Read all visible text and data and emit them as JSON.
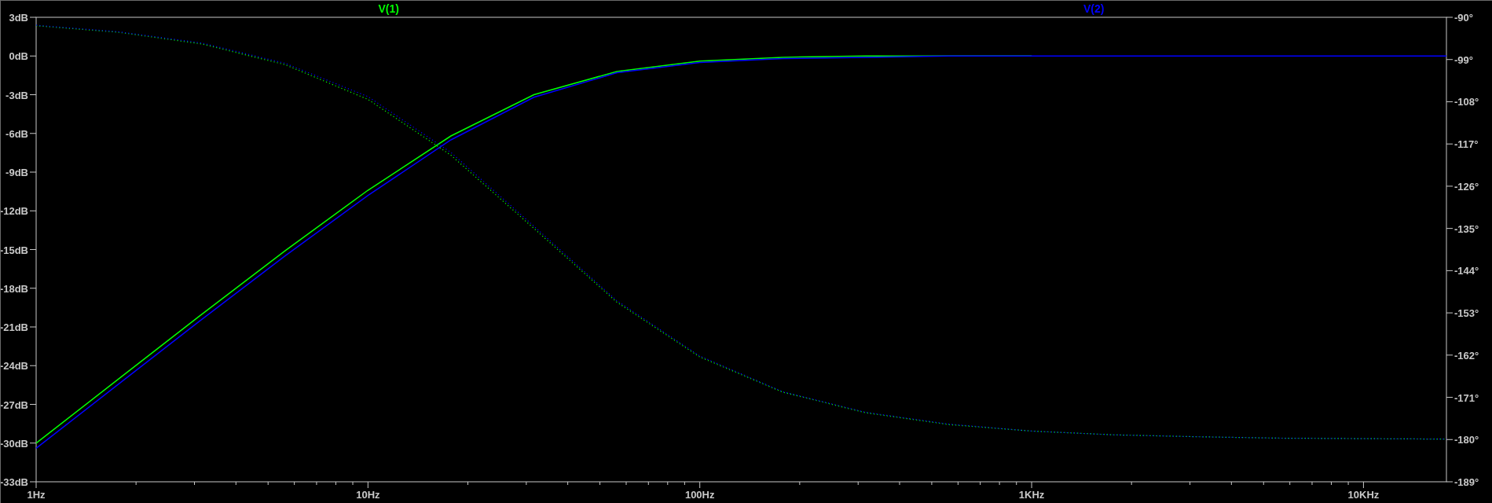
{
  "plot": {
    "chart_data": {
      "type": "line",
      "categories": [
        "1Hz",
        null,
        null,
        null,
        "10Hz",
        null,
        null,
        null,
        "100Hz",
        null,
        null,
        null,
        "1KHz",
        null,
        null,
        null,
        "10KHz",
        null
      ],
      "ylim": [
        -33,
        3
      ],
      "y2lim": [
        -189,
        -90
      ],
      "yticks": [
        {
          "value": 3,
          "label": "3dB"
        },
        {
          "value": 0,
          "label": "0dB"
        },
        {
          "value": -3,
          "label": "-3dB"
        },
        {
          "value": -6,
          "label": "-6dB"
        },
        {
          "value": -9,
          "label": "-9dB"
        },
        {
          "value": -12,
          "label": "-12dB"
        },
        {
          "value": -15,
          "label": "-15dB"
        },
        {
          "value": -18,
          "label": "-18dB"
        },
        {
          "value": -21,
          "label": "-21dB"
        },
        {
          "value": -24,
          "label": "-24dB"
        },
        {
          "value": -27,
          "label": "-27dB"
        },
        {
          "value": -30,
          "label": "-30dB"
        },
        {
          "value": -33,
          "label": "-33dB"
        }
      ],
      "y2ticks": [
        {
          "value": -90,
          "label": "-90°"
        },
        {
          "value": -99,
          "label": "-99°"
        },
        {
          "value": -108,
          "label": "-108°"
        },
        {
          "value": -117,
          "label": "-117°"
        },
        {
          "value": -126,
          "label": "-126°"
        },
        {
          "value": -135,
          "label": "-135°"
        },
        {
          "value": -144,
          "label": "-144°"
        },
        {
          "value": -153,
          "label": "-153°"
        },
        {
          "value": -162,
          "label": "-162°"
        },
        {
          "value": -171,
          "label": "-171°"
        },
        {
          "value": -180,
          "label": "-180°"
        },
        {
          "value": -189,
          "label": "-189°"
        }
      ],
      "series": [
        {
          "name": "V(1)",
          "color": "#00ff00",
          "values": [
            -30.0,
            -25.0,
            -20.0,
            -15.1,
            -10.4,
            -6.2,
            -3.0,
            -1.2,
            -0.4,
            -0.1,
            0,
            0,
            0,
            null,
            null,
            null,
            null,
            null
          ]
        },
        {
          "name": "V(2)",
          "color": "#0000ff",
          "values": [
            -30.4,
            -25.4,
            -20.4,
            -15.5,
            -10.8,
            -6.5,
            -3.2,
            -1.3,
            -0.5,
            -0.2,
            -0.1,
            0,
            0,
            0,
            0,
            0,
            0,
            0
          ]
        },
        {
          "color": "#00ff00",
          "axis": "y2",
          "line_style": "dotted",
          "values": [
            -91.8,
            -93.2,
            -95.7,
            -100.1,
            -107.5,
            -119.4,
            -135.0,
            -150.7,
            -162.4,
            -169.9,
            -174.3,
            -176.8,
            -178.2,
            -179.0,
            -179.4,
            -179.7,
            -179.8,
            -179.9
          ]
        },
        {
          "color": "#0000ff",
          "axis": "y2",
          "line_style": "dotted",
          "values": [
            -91.7,
            -93.1,
            -95.5,
            -99.8,
            -106.9,
            -118.8,
            -134.5,
            -150.4,
            -162.2,
            -169.8,
            -174.2,
            -176.7,
            -178.2,
            -179.0,
            -179.4,
            -179.7,
            -179.8,
            -179.9
          ]
        }
      ]
    }
  }
}
